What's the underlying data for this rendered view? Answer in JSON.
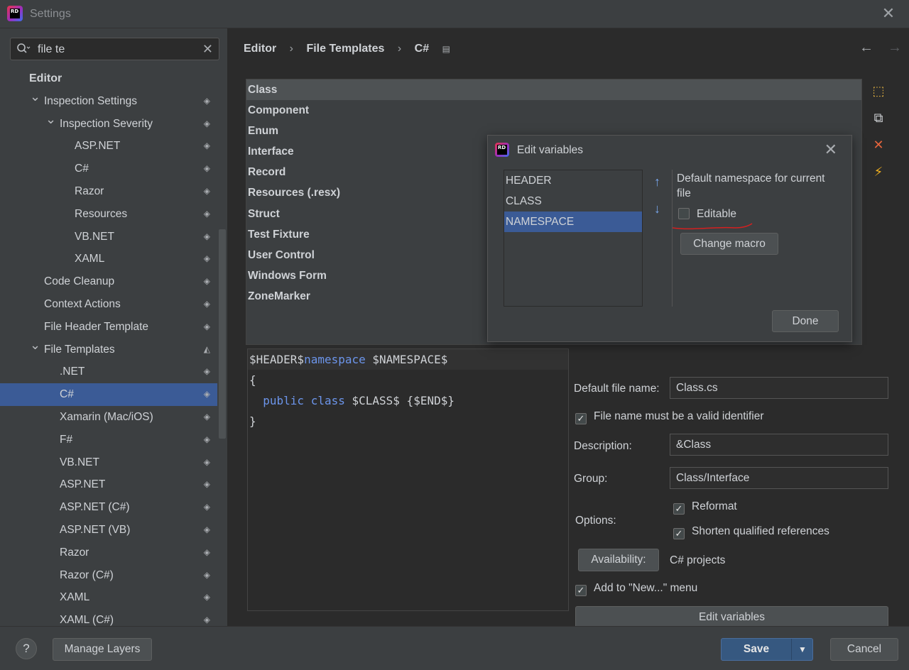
{
  "window": {
    "title": "Settings",
    "close_glyph": "✕"
  },
  "search": {
    "value": "file te",
    "clear_glyph": "✕"
  },
  "tree": [
    {
      "label": "Editor",
      "level": 0,
      "header": true
    },
    {
      "label": "Inspection Settings",
      "level": 1,
      "expanded": true
    },
    {
      "label": "Inspection Severity",
      "level": 2,
      "expanded": true
    },
    {
      "label": "ASP.NET",
      "level": 3
    },
    {
      "label": "C#",
      "level": 3
    },
    {
      "label": "Razor",
      "level": 3
    },
    {
      "label": "Resources",
      "level": 3
    },
    {
      "label": "VB.NET",
      "level": 3
    },
    {
      "label": "XAML",
      "level": 3
    },
    {
      "label": "Code Cleanup",
      "level": 1
    },
    {
      "label": "Context Actions",
      "level": 1
    },
    {
      "label": "File Header Template",
      "level": 1
    },
    {
      "label": "File Templates",
      "level": 1,
      "expanded": true,
      "half_layers": true
    },
    {
      "label": ".NET",
      "level": 2
    },
    {
      "label": "C#",
      "level": 2,
      "selected": true
    },
    {
      "label": "Xamarin (Mac/iOS)",
      "level": 2
    },
    {
      "label": "F#",
      "level": 2
    },
    {
      "label": "VB.NET",
      "level": 2
    },
    {
      "label": "ASP.NET",
      "level": 2
    },
    {
      "label": "ASP.NET (C#)",
      "level": 2
    },
    {
      "label": "ASP.NET (VB)",
      "level": 2
    },
    {
      "label": "Razor",
      "level": 2
    },
    {
      "label": "Razor (C#)",
      "level": 2
    },
    {
      "label": "XAML",
      "level": 2
    },
    {
      "label": "XAML (C#)",
      "level": 2
    }
  ],
  "breadcrumb": {
    "part1": "Editor",
    "part2": "File Templates",
    "part3": "C#",
    "sep": "›"
  },
  "templates": [
    "Class",
    "Component",
    "Enum",
    "Interface",
    "Record",
    "Resources (.resx)",
    "Struct",
    "Test Fixture",
    "User Control",
    "Windows Form",
    "ZoneMarker"
  ],
  "selected_template": "Class",
  "editor": {
    "line1_a": "$HEADER$",
    "line1_kw": "namespace",
    "line1_b": " $NAMESPACE$",
    "line2": "{",
    "line3_indent": "  ",
    "line3_kw": "public class",
    "line3_b": " $CLASS$ {$END$}",
    "line4": "}"
  },
  "props": {
    "default_file_name_label": "Default file name:",
    "default_file_name": "Class.cs",
    "valid_identifier_label": "File name must be a valid identifier",
    "description_label": "Description:",
    "description": "&Class",
    "group_label": "Group:",
    "group": "Class/Interface",
    "options_label": "Options:",
    "reformat_label": "Reformat",
    "shorten_label": "Shorten qualified references",
    "availability_button": "Availability:",
    "availability_value": "C# projects",
    "add_to_new_label": "Add to \"New...\" menu",
    "edit_variables_button": "Edit variables"
  },
  "dialog": {
    "title": "Edit variables",
    "variables": [
      "HEADER",
      "CLASS",
      "NAMESPACE"
    ],
    "selected_variable": "NAMESPACE",
    "description": "Default namespace for current file",
    "editable_label": "Editable",
    "change_macro_button": "Change macro",
    "done_button": "Done"
  },
  "footer": {
    "help": "?",
    "manage_layers": "Manage Layers",
    "save": "Save",
    "cancel": "Cancel"
  },
  "colors": {
    "accent": "#365880",
    "selection": "#3b5b96",
    "keyword": "#6c95eb",
    "annotation": "#d42020"
  }
}
